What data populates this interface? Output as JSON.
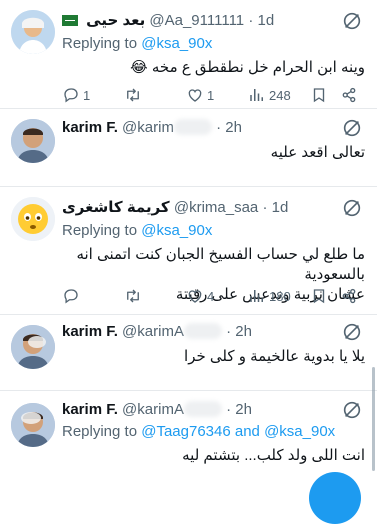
{
  "tweets": [
    {
      "name": "بعد حيى",
      "handle": "@Aa_9111111",
      "time": "1d",
      "reply_prefix": "Replying to",
      "mentions": [
        "@ksa_90x"
      ],
      "text": "وينه ابن الحرام خل نطقطق ع مخه 😂",
      "stats": {
        "replies": "1",
        "retweets": "",
        "likes": "1",
        "views": "248"
      }
    },
    {
      "name": "karim F.",
      "handle": "@karim",
      "time": "2h",
      "text": "تعالى اقعد عليه"
    },
    {
      "name": "كريمة كاشغرى",
      "handle": "@krima_saa",
      "time": "1d",
      "reply_prefix": "Replying to",
      "mentions": [
        "@ksa_90x"
      ],
      "text_line1": "ما طلع لي حساب الفسيخ الجبان كنت اتمنى انه بالسعودية",
      "text_line2": "عشان نربية وندعس على رقبتة",
      "stats": {
        "replies": "",
        "retweets": "",
        "likes": "4",
        "views": "180"
      }
    },
    {
      "name": "karim F.",
      "handle": "@karimA",
      "time": "2h",
      "text": "يلا يا بدوية عالخيمة و كلى خرا"
    },
    {
      "name": "karim F.",
      "handle": "@karimA",
      "time": "2h",
      "reply_prefix": "Replying to",
      "mentions": [
        "@Taag76346",
        "and",
        "@ksa_90x"
      ],
      "text": "انت اللى ولد كلب... بتشتم ليه"
    }
  ],
  "separator": "·",
  "icons": {
    "reply": "reply-icon",
    "retweet": "retweet-icon",
    "like": "heart-icon",
    "views": "views-icon",
    "bookmark": "bookmark-icon",
    "share": "share-icon",
    "more": "grok-icon"
  },
  "colors": {
    "accent": "#1d9bf0",
    "muted": "#536471",
    "text": "#0f1419"
  }
}
